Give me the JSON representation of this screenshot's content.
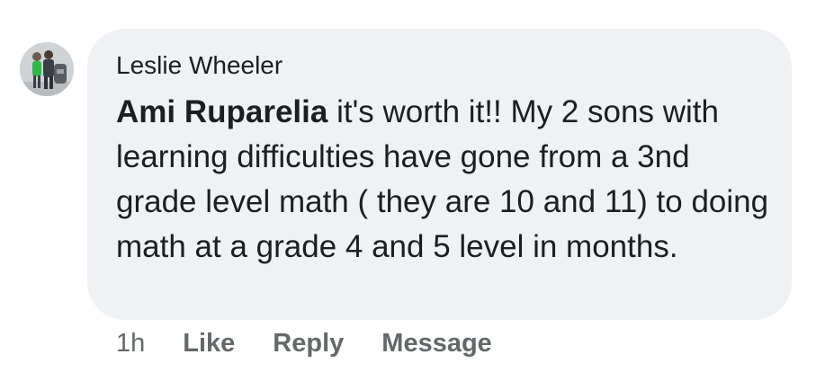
{
  "comment": {
    "author": "Leslie Wheeler",
    "mention": "Ami Ruparelia",
    "text": " it's worth it!! My 2 sons with learning difficulties have gone from a 3nd grade level math ( they are 10 and 11) to doing math at a grade 4 and 5 level in months.",
    "bubble_color": "#f0f1f5"
  },
  "actions": {
    "time": "1h",
    "like": "Like",
    "reply": "Reply",
    "message": "Message"
  },
  "avatar": {
    "icon": "user-photo-avatar"
  }
}
